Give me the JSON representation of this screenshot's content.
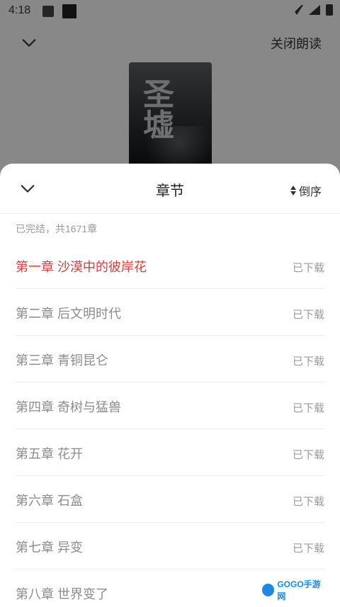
{
  "status_bar": {
    "time": "4:18"
  },
  "player": {
    "close_reading_label": "关闭朗读"
  },
  "cover": {
    "calligraphy": "圣墟"
  },
  "sheet": {
    "title": "章节",
    "sort_label": "倒序",
    "summary": "已完结，共1671章",
    "chapters": [
      {
        "title": "第一章 沙漠中的彼岸花",
        "status": "已下载",
        "active": true
      },
      {
        "title": "第二章 后文明时代",
        "status": "已下载"
      },
      {
        "title": "第三章 青铜昆仑",
        "status": "已下载"
      },
      {
        "title": "第四章 奇树与猛兽",
        "status": "已下载"
      },
      {
        "title": "第五章 花开",
        "status": "已下载"
      },
      {
        "title": "第六章 石盒",
        "status": "已下载"
      },
      {
        "title": "第七章 异变",
        "status": "已下载"
      },
      {
        "title": "第八章 世界变了",
        "status": ""
      }
    ]
  },
  "watermark": {
    "text": "GOGO手游网"
  },
  "colors": {
    "accent": "#d93a3a",
    "muted": "#9a9a9a"
  }
}
